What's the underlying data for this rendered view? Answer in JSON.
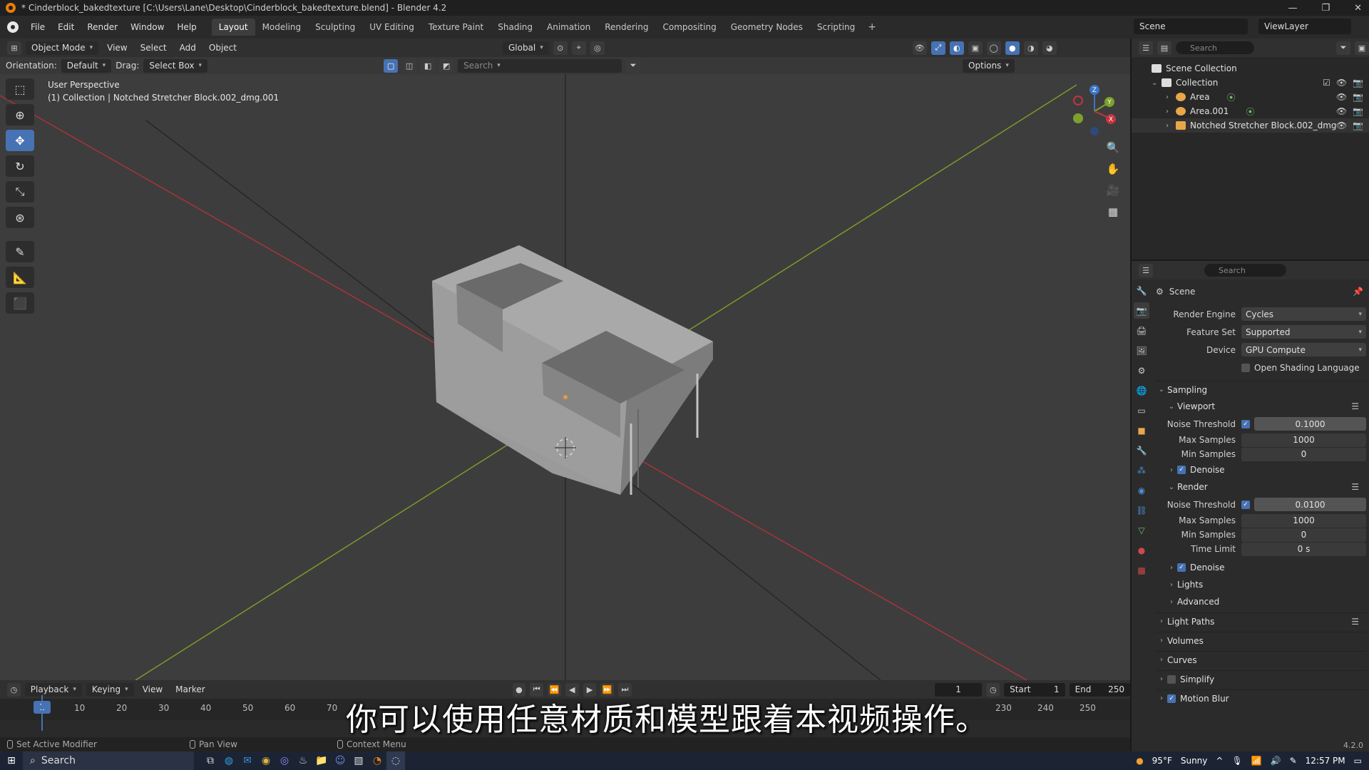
{
  "window": {
    "title": "* Cinderblock_bakedtexture [C:\\Users\\Lane\\Desktop\\Cinderblock_bakedtexture.blend] - Blender 4.2"
  },
  "menu": [
    "File",
    "Edit",
    "Render",
    "Window",
    "Help"
  ],
  "workspaces": [
    "Layout",
    "Modeling",
    "Sculpting",
    "UV Editing",
    "Texture Paint",
    "Shading",
    "Animation",
    "Rendering",
    "Compositing",
    "Geometry Nodes",
    "Scripting"
  ],
  "active_workspace": "Layout",
  "scene_name": "Scene",
  "view_layer": "ViewLayer",
  "viewport": {
    "mode": "Object Mode",
    "header_menus": [
      "View",
      "Select",
      "Add",
      "Object"
    ],
    "transform_orientation": "Global",
    "orientation_label": "Orientation:",
    "orientation_value": "Default",
    "drag_label": "Drag:",
    "drag_value": "Select Box",
    "search_placeholder": "Search",
    "options_label": "Options",
    "perspective": "User Perspective",
    "collection_info": "(1) Collection | Notched Stretcher Block.002_dmg.001"
  },
  "gizmo_axes": {
    "z": "Z",
    "y": "Y",
    "x": "X"
  },
  "outliner": {
    "search_placeholder": "Search",
    "scene_collection": "Scene Collection",
    "collection": "Collection",
    "items": [
      "Area",
      "Area.001",
      "Notched Stretcher Block.002_dmg"
    ]
  },
  "properties": {
    "search_placeholder": "Search",
    "context": "Scene",
    "render_engine_label": "Render Engine",
    "render_engine": "Cycles",
    "feature_set_label": "Feature Set",
    "feature_set": "Supported",
    "device_label": "Device",
    "device": "GPU Compute",
    "osl_label": "Open Shading Language",
    "sampling": "Sampling",
    "viewport_section": "Viewport",
    "render_section": "Render",
    "noise_threshold_label": "Noise Threshold",
    "viewport_noise_threshold": "0.1000",
    "max_samples_label": "Max Samples",
    "viewport_max_samples": "1000",
    "min_samples_label": "Min Samples",
    "viewport_min_samples": "0",
    "denoise_label": "Denoise",
    "render_noise_threshold": "0.0100",
    "render_max_samples": "1000",
    "render_min_samples": "0",
    "time_limit_label": "Time Limit",
    "time_limit": "0 s",
    "lights": "Lights",
    "advanced": "Advanced",
    "light_paths": "Light Paths",
    "volumes": "Volumes",
    "curves": "Curves",
    "simplify": "Simplify",
    "motion_blur": "Motion Blur"
  },
  "timeline": {
    "menus": [
      "Playback",
      "Keying",
      "View",
      "Marker"
    ],
    "current_frame": "1",
    "start_label": "Start",
    "start": "1",
    "end_label": "End",
    "end": "250",
    "ruler": [
      "1",
      "10",
      "20",
      "30",
      "40",
      "50",
      "60",
      "70",
      "230",
      "240",
      "250"
    ]
  },
  "status_bar": {
    "left": "Set Active Modifier",
    "middle": "Pan View",
    "right": "Context Menu",
    "version": "4.2.0"
  },
  "subtitle": "你可以使用任意材质和模型跟着本视频操作。",
  "taskbar": {
    "search": "Search",
    "weather_temp": "95°F",
    "weather": "Sunny",
    "time": "12:57 PM"
  }
}
